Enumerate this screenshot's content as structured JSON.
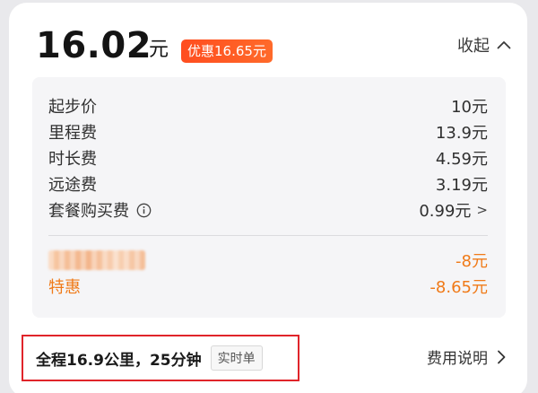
{
  "header": {
    "price": "16.02",
    "unit": "元",
    "discount_badge": "优惠16.65元",
    "collapse_label": "收起"
  },
  "breakdown": [
    {
      "label": "起步价",
      "value": "10元"
    },
    {
      "label": "里程费",
      "value": "13.9元"
    },
    {
      "label": "时长费",
      "value": "4.59元"
    },
    {
      "label": "远途费",
      "value": "3.19元"
    },
    {
      "label": "套餐购买费",
      "value": "0.99元",
      "has_info": true,
      "chevron": ">"
    }
  ],
  "discounts": [
    {
      "label": "",
      "value": "-8元",
      "blurred": true
    },
    {
      "label": "特惠",
      "value": "-8.65元"
    }
  ],
  "footer": {
    "summary": "全程16.9公里，25分钟",
    "tag": "实时单",
    "fee_explain": "费用说明"
  },
  "colors": {
    "accent_orange": "#f07a18",
    "badge_red": "#ff4d1f",
    "highlight_border": "#e0242a"
  }
}
